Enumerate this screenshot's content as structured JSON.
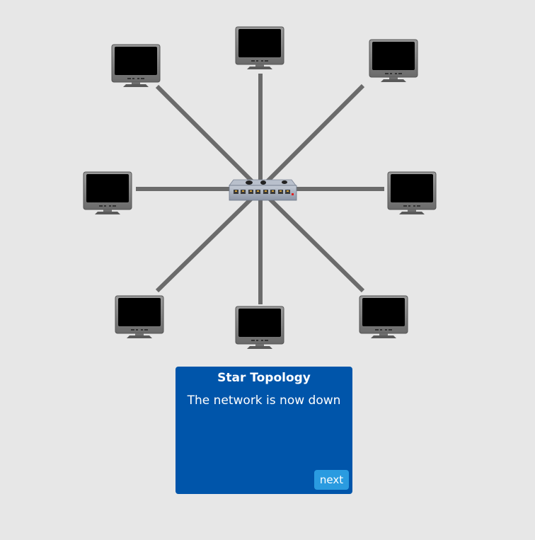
{
  "diagram": {
    "type": "star-topology",
    "hub": {
      "icon": "network-switch-icon"
    },
    "nodes": [
      {
        "id": "top-left",
        "icon": "computer-monitor-icon"
      },
      {
        "id": "top",
        "icon": "computer-monitor-icon"
      },
      {
        "id": "top-right",
        "icon": "computer-monitor-icon"
      },
      {
        "id": "left",
        "icon": "computer-monitor-icon"
      },
      {
        "id": "right",
        "icon": "computer-monitor-icon"
      },
      {
        "id": "bottom-left",
        "icon": "computer-monitor-icon"
      },
      {
        "id": "bottom",
        "icon": "computer-monitor-icon"
      },
      {
        "id": "bottom-right",
        "icon": "computer-monitor-icon"
      }
    ],
    "link_color": "#6b6b6b"
  },
  "info_box": {
    "title": "Star Topology",
    "message": "The network is now down",
    "next_label": "next",
    "background_color": "#0055aa",
    "button_color": "#2a9be0"
  }
}
